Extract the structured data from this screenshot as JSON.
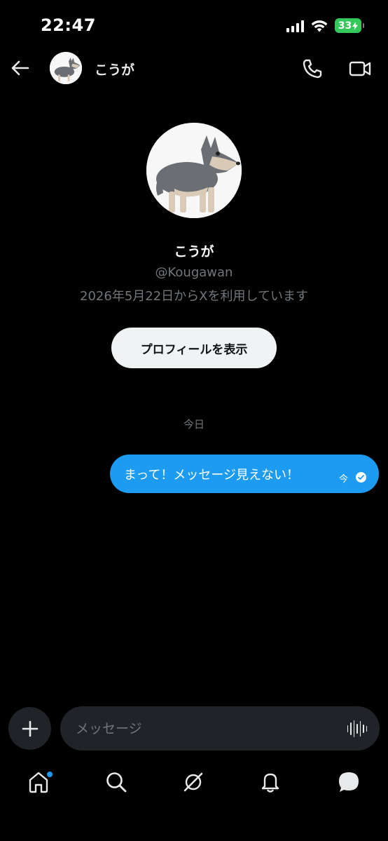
{
  "status_bar": {
    "time": "22:47",
    "battery_level": "33",
    "battery_color": "#34c759"
  },
  "header": {
    "contact_name": "こうが",
    "avatar_icon": "wolf-avatar-icon",
    "back_icon": "arrow-left-icon",
    "call_icon": "phone-icon",
    "video_icon": "video-camera-icon"
  },
  "profile": {
    "name": "こうが",
    "handle": "@Kougawan",
    "joined": "2026年5月22日からXを利用しています",
    "view_profile_label": "プロフィールを表示"
  },
  "conversation": {
    "date_separator": "今日",
    "messages": [
      {
        "text": "まって！メッセージ見えない！",
        "time": "今",
        "direction": "outgoing",
        "status": "read"
      }
    ]
  },
  "composer": {
    "placeholder": "メッセージ",
    "add_icon": "plus-icon",
    "voice_icon": "waveform-icon"
  },
  "bottom_nav": {
    "items": [
      {
        "icon": "home-icon",
        "has_badge": true
      },
      {
        "icon": "search-icon",
        "has_badge": false
      },
      {
        "icon": "grok-icon",
        "has_badge": false
      },
      {
        "icon": "bell-icon",
        "has_badge": false
      },
      {
        "icon": "messages-icon",
        "has_badge": false
      }
    ]
  },
  "colors": {
    "accent": "#1d9bf0",
    "background": "#000000",
    "secondary_text": "#71767b"
  }
}
